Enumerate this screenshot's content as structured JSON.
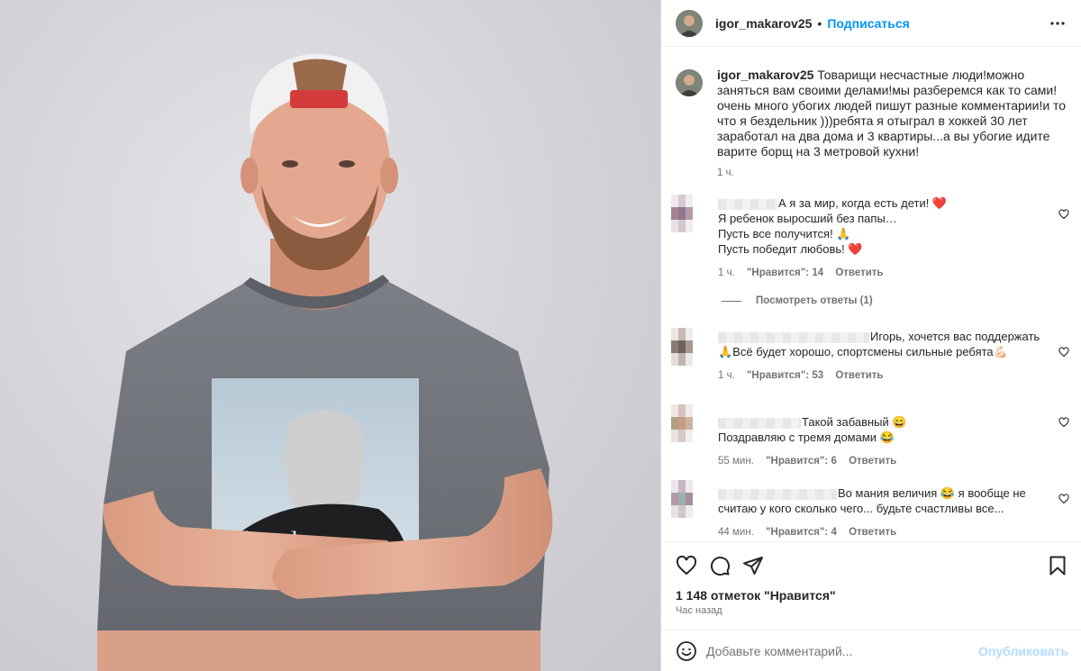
{
  "post": {
    "username": "igor_makarov25",
    "follow_label": "Подписаться",
    "separator": "•",
    "more_icon": "more-horizontal-icon",
    "photo_print_text": "thou    log"
  },
  "caption": {
    "username": "igor_makarov25",
    "text": " Товарищи несчастные люди!можно заняться вам своими делами!мы разберемся как то сами!очень много убогих людей пишут разные комментарии!и то что я бездельник )))ребята я отыграл в хоккей 30 лет заработал на два дома и 3 квартиры...а вы убогие идите варите борщ на 3 метровой кухни!",
    "time": "1 ч."
  },
  "comments": [
    {
      "lines": [
        "А я за мир, когда есть дети! ❤️",
        "Я ребенок выросший без папы…",
        "Пусть все получится! 🙏",
        "Пусть победит любовь! ❤️"
      ],
      "time": "1 ч.",
      "likes": "\"Нравится\": 14",
      "reply": "Ответить",
      "view_replies": "Посмотреть ответы (1)"
    },
    {
      "lines": [
        "Игорь, хочется вас поддержать 🙏Всё будет хорошо, спортсмены сильные ребята💪🏻"
      ],
      "time": "1 ч.",
      "likes": "\"Нравится\": 53",
      "reply": "Ответить"
    },
    {
      "lines": [
        "Такой забавный 😄",
        "Поздравляю с тремя домами 😂"
      ],
      "time": "55 мин.",
      "likes": "\"Нравится\": 6",
      "reply": "Ответить"
    },
    {
      "lines": [
        "Во мания величия 😂 я вообще не считаю у кого сколько чего... будьте счастливы все..."
      ],
      "time": "44 мин.",
      "likes": "\"Нравится\": 4",
      "reply": "Ответить"
    }
  ],
  "actions": {
    "like_icon": "heart-icon",
    "comment_icon": "comment-bubble-icon",
    "share_icon": "paper-plane-icon",
    "save_icon": "bookmark-icon",
    "likes_count": "1 148 отметок \"Нравится\"",
    "posted_ago": "Час назад"
  },
  "composer": {
    "emoji_icon": "smiley-icon",
    "placeholder": "Добавьте комментарий...",
    "publish_label": "Опубликовать"
  },
  "colors": {
    "link_blue": "#0095f6",
    "publish_disabled": "#b3dbff",
    "secondary_text": "#737373"
  }
}
